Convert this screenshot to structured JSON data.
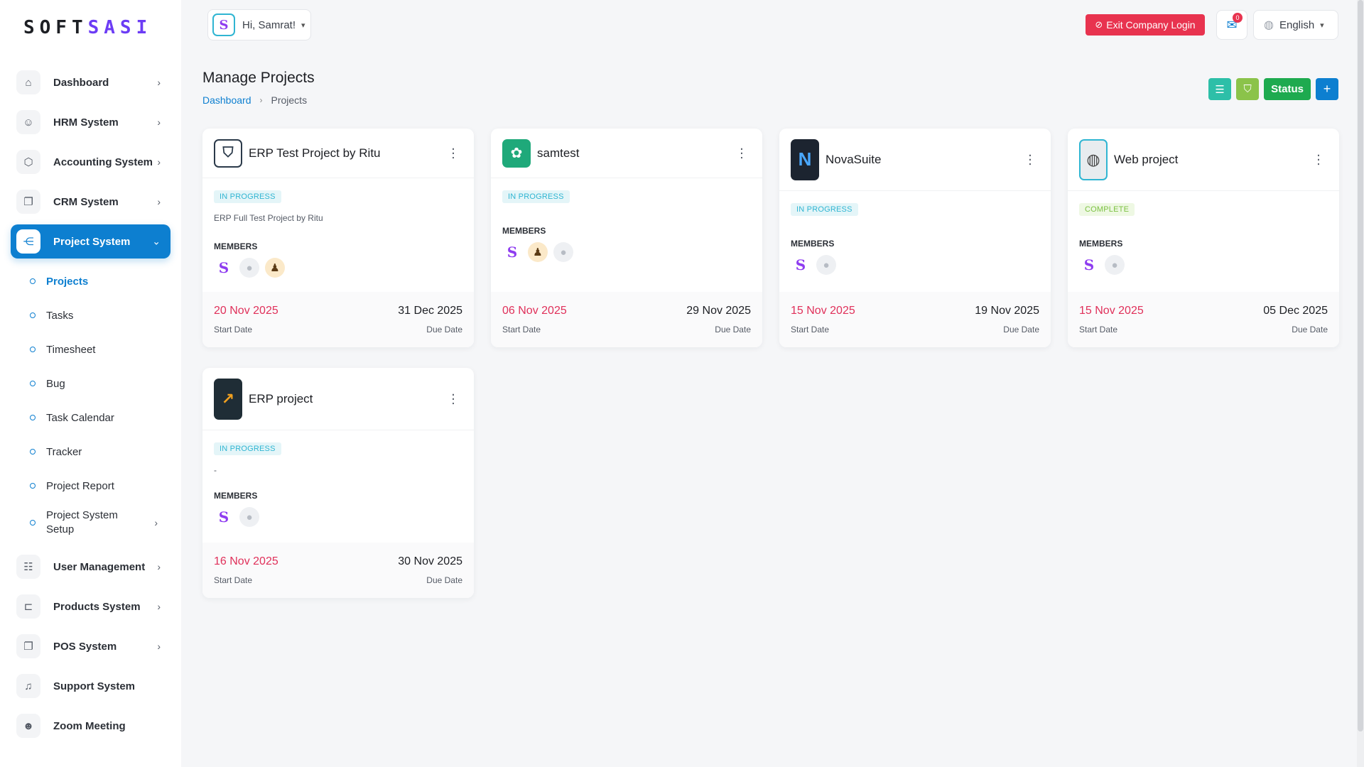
{
  "brand": {
    "logo_main": "SOFT",
    "logo_accent": "SASI"
  },
  "header": {
    "greeting": "Hi, Samrat!",
    "exit_label": "Exit Company Login",
    "notif_count": "0",
    "language": "English"
  },
  "colors": {
    "primary": "#0d7fd0",
    "danger": "#e8334f",
    "success": "#1eaa4f",
    "teal": "#2dbfa8",
    "lime": "#8bc34a"
  },
  "sidebar": {
    "items": [
      {
        "label": "Dashboard",
        "icon": "home-icon"
      },
      {
        "label": "HRM System",
        "icon": "user-icon"
      },
      {
        "label": "Accounting System",
        "icon": "box-icon"
      },
      {
        "label": "CRM System",
        "icon": "layers-icon"
      },
      {
        "label": "Project System",
        "icon": "share-icon"
      }
    ],
    "project_sub": [
      {
        "label": "Projects"
      },
      {
        "label": "Tasks"
      },
      {
        "label": "Timesheet"
      },
      {
        "label": "Bug"
      },
      {
        "label": "Task Calendar"
      },
      {
        "label": "Tracker"
      },
      {
        "label": "Project Report"
      },
      {
        "label": "Project System Setup"
      }
    ],
    "items_after": [
      {
        "label": "User Management",
        "icon": "users-icon"
      },
      {
        "label": "Products System",
        "icon": "cart-icon"
      },
      {
        "label": "POS System",
        "icon": "layers-icon"
      },
      {
        "label": "Support System",
        "icon": "headset-icon"
      },
      {
        "label": "Zoom Meeting",
        "icon": "user-plus-icon"
      }
    ]
  },
  "page": {
    "title": "Manage Projects",
    "breadcrumb": [
      "Dashboard",
      "Projects"
    ],
    "status_label": "Status"
  },
  "projects": [
    {
      "name": "ERP Test Project by Ritu",
      "status": "IN PROGRESS",
      "description": "ERP Full Test Project by Ritu",
      "members_label": "MEMBERS",
      "start": "20 Nov 2025",
      "due": "31 Dec 2025",
      "start_label": "Start Date",
      "due_label": "Due Date"
    },
    {
      "name": "samtest",
      "status": "IN PROGRESS",
      "description": "",
      "members_label": "MEMBERS",
      "start": "06 Nov 2025",
      "due": "29 Nov 2025",
      "start_label": "Start Date",
      "due_label": "Due Date"
    },
    {
      "name": "NovaSuite",
      "status": "IN PROGRESS",
      "description": "",
      "members_label": "MEMBERS",
      "start": "15 Nov 2025",
      "due": "19 Nov 2025",
      "start_label": "Start Date",
      "due_label": "Due Date"
    },
    {
      "name": "Web project",
      "status": "COMPLETE",
      "description": "",
      "members_label": "MEMBERS",
      "start": "15 Nov 2025",
      "due": "05 Dec 2025",
      "start_label": "Start Date",
      "due_label": "Due Date"
    },
    {
      "name": "ERP project",
      "status": "IN PROGRESS",
      "description": "-",
      "members_label": "MEMBERS",
      "start": "16 Nov 2025",
      "due": "30 Nov 2025",
      "start_label": "Start Date",
      "due_label": "Due Date"
    }
  ]
}
